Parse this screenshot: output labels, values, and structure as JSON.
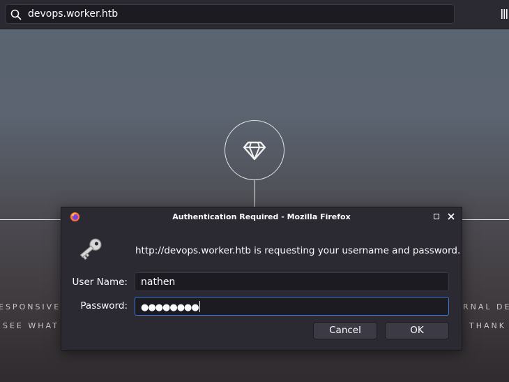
{
  "browser": {
    "url": "devops.worker.htb"
  },
  "page": {
    "left_text_1": "ESPONSIVE",
    "left_text_2": "SEE WHAT M",
    "right_text_1": "RNAL DE",
    "right_text_2": "THANK"
  },
  "dialog": {
    "title": "Authentication Required - Mozilla Firefox",
    "message": "http://devops.worker.htb is requesting your username and password.",
    "username_label": "User Name:",
    "username_value": "nathen",
    "password_label": "Password:",
    "password_value": "●●●●●●●●",
    "cancel_label": "Cancel",
    "ok_label": "OK"
  },
  "colors": {
    "accent": "#3c79d9",
    "dialog_bg": "#2b2a33",
    "field_bg": "#1c1b22"
  }
}
